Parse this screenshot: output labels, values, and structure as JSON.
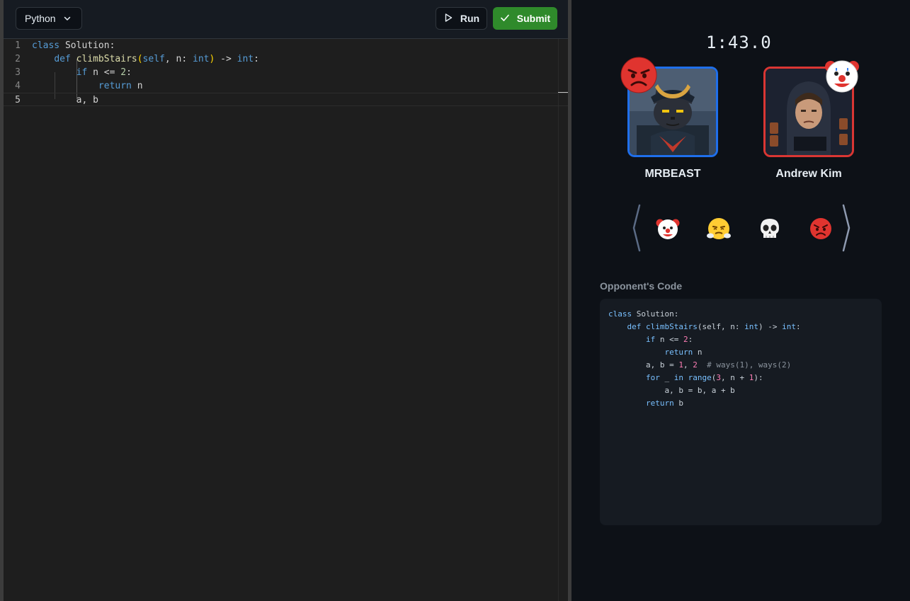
{
  "toolbar": {
    "language": "Python",
    "run_label": "Run",
    "submit_label": "Submit"
  },
  "editor": {
    "lines": [
      {
        "num": "1",
        "tokens": [
          {
            "t": "class",
            "c": "kw"
          },
          {
            "t": " Solution:",
            "c": "txt"
          }
        ]
      },
      {
        "num": "2",
        "tokens": [
          {
            "t": "    ",
            "c": "txt"
          },
          {
            "t": "def",
            "c": "kw"
          },
          {
            "t": " ",
            "c": "txt"
          },
          {
            "t": "climbStairs",
            "c": "fn"
          },
          {
            "t": "(",
            "c": "brk"
          },
          {
            "t": "self",
            "c": "self"
          },
          {
            "t": ", n: ",
            "c": "txt"
          },
          {
            "t": "int",
            "c": "kw"
          },
          {
            "t": ")",
            "c": "brk"
          },
          {
            "t": " -> ",
            "c": "txt"
          },
          {
            "t": "int",
            "c": "kw"
          },
          {
            "t": ":",
            "c": "txt"
          }
        ]
      },
      {
        "num": "3",
        "tokens": [
          {
            "t": "        ",
            "c": "txt"
          },
          {
            "t": "if",
            "c": "kw"
          },
          {
            "t": " n <= ",
            "c": "txt"
          },
          {
            "t": "2",
            "c": "num"
          },
          {
            "t": ":",
            "c": "txt"
          }
        ]
      },
      {
        "num": "4",
        "tokens": [
          {
            "t": "            ",
            "c": "txt"
          },
          {
            "t": "return",
            "c": "kw"
          },
          {
            "t": " n",
            "c": "txt"
          }
        ]
      },
      {
        "num": "5",
        "tokens": [
          {
            "t": "        a, b",
            "c": "txt"
          }
        ]
      }
    ]
  },
  "match": {
    "timer": "1:43.0",
    "player1": {
      "name": "MRBEAST",
      "reaction": "angry-face"
    },
    "player2": {
      "name": "Andrew Kim",
      "reaction": "clown-face"
    }
  },
  "reactions": [
    "clown-face",
    "steam-face",
    "skull",
    "angry-face"
  ],
  "opponent": {
    "title": "Opponent's Code",
    "lines": [
      [
        {
          "t": "class",
          "c": "o-kw"
        },
        {
          "t": " Solution:",
          "c": ""
        }
      ],
      [
        {
          "t": "    ",
          "c": ""
        },
        {
          "t": "def",
          "c": "o-kw"
        },
        {
          "t": " ",
          "c": ""
        },
        {
          "t": "climbStairs",
          "c": "o-kw"
        },
        {
          "t": "(self, n: ",
          "c": ""
        },
        {
          "t": "int",
          "c": "o-kw"
        },
        {
          "t": ") -> ",
          "c": ""
        },
        {
          "t": "int",
          "c": "o-kw"
        },
        {
          "t": ":",
          "c": ""
        }
      ],
      [
        {
          "t": "        ",
          "c": ""
        },
        {
          "t": "if",
          "c": "o-kw"
        },
        {
          "t": " n <= ",
          "c": ""
        },
        {
          "t": "2",
          "c": "o-mag"
        },
        {
          "t": ":",
          "c": ""
        }
      ],
      [
        {
          "t": "            ",
          "c": ""
        },
        {
          "t": "return",
          "c": "o-kw"
        },
        {
          "t": " n",
          "c": ""
        }
      ],
      [
        {
          "t": "        a, b = ",
          "c": ""
        },
        {
          "t": "1",
          "c": "o-mag"
        },
        {
          "t": ", ",
          "c": ""
        },
        {
          "t": "2",
          "c": "o-mag"
        },
        {
          "t": "  # ways(1), ways(2)",
          "c": "o-cm"
        }
      ],
      [
        {
          "t": "        ",
          "c": ""
        },
        {
          "t": "for",
          "c": "o-kw"
        },
        {
          "t": " _ ",
          "c": ""
        },
        {
          "t": "in",
          "c": "o-kw"
        },
        {
          "t": " ",
          "c": ""
        },
        {
          "t": "range",
          "c": "o-kw"
        },
        {
          "t": "(",
          "c": ""
        },
        {
          "t": "3",
          "c": "o-mag"
        },
        {
          "t": ", n + ",
          "c": ""
        },
        {
          "t": "1",
          "c": "o-mag"
        },
        {
          "t": "):",
          "c": ""
        }
      ],
      [
        {
          "t": "            a, b = b, a + b",
          "c": ""
        }
      ],
      [
        {
          "t": "        ",
          "c": ""
        },
        {
          "t": "return",
          "c": "o-kw"
        },
        {
          "t": " b",
          "c": ""
        }
      ]
    ]
  },
  "colors": {
    "accent_green": "#2f8a2b",
    "player1_border": "#1f6feb",
    "player2_border": "#da3633"
  }
}
